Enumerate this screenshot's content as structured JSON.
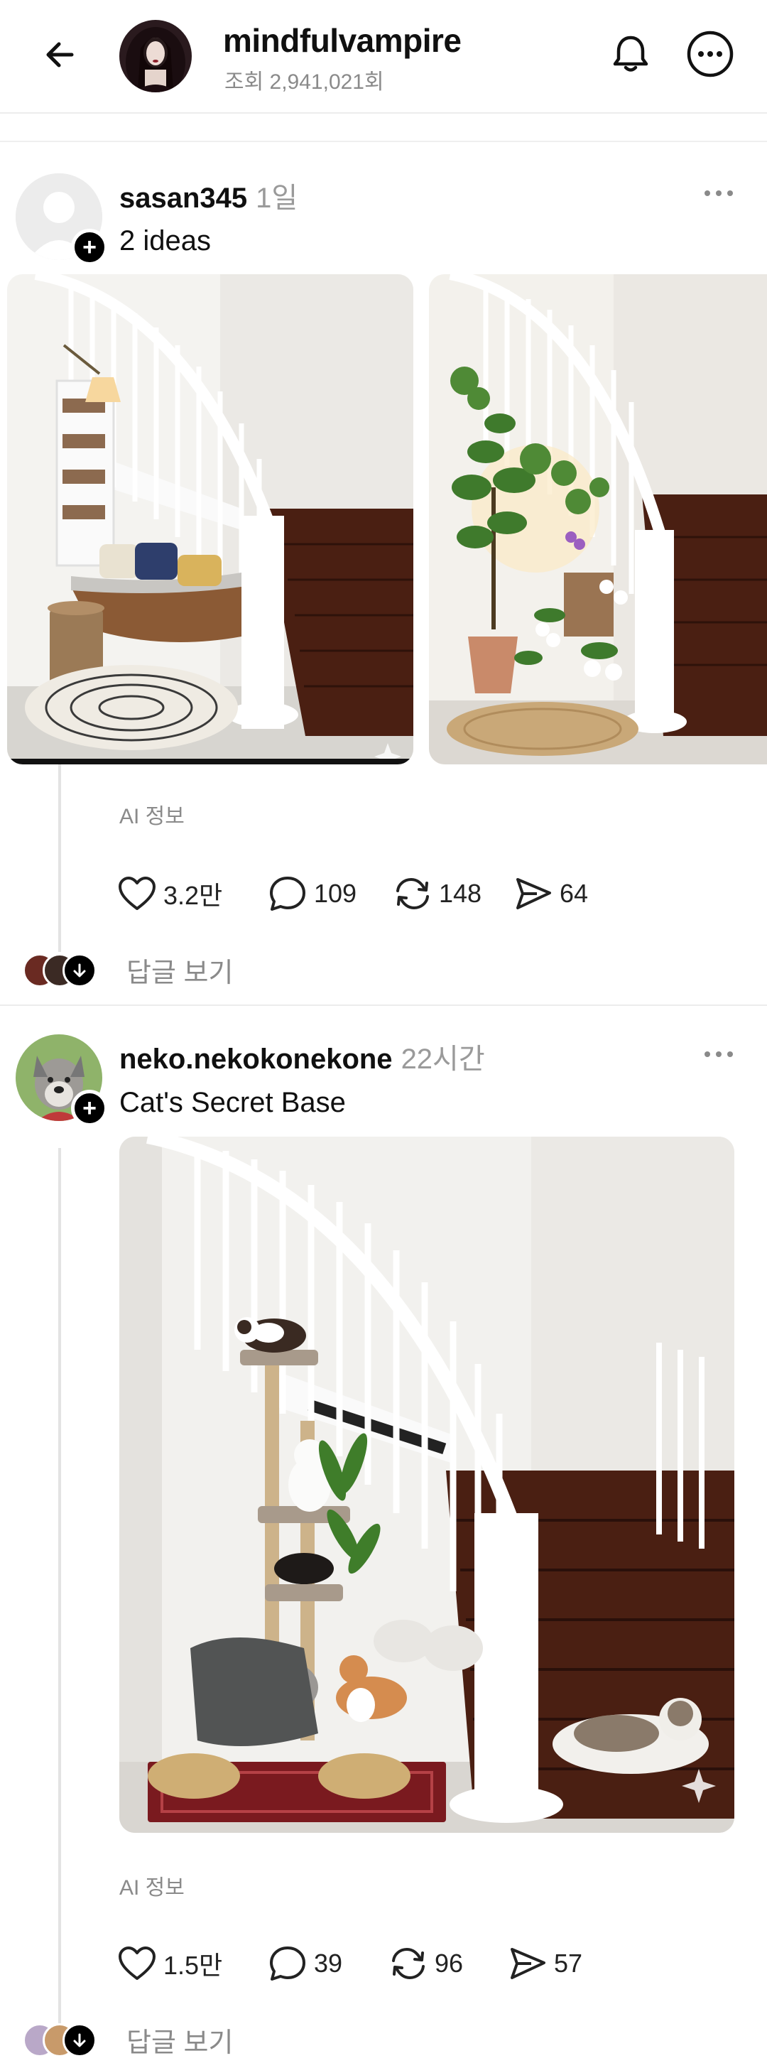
{
  "header": {
    "back_icon": "arrow-left-icon",
    "name": "mindfulvampire",
    "views": "조회 2,941,021회",
    "bell_icon": "bell-icon",
    "more_icon": "more-circle-icon"
  },
  "posts": [
    {
      "username": "sasan345",
      "time": "1일",
      "text": "2 ideas",
      "photos": [
        "reading-nook-under-stairs-photo",
        "plant-corner-under-stairs-photo"
      ],
      "ai_info": "AI 정보",
      "likes": "3.2만",
      "comments": "109",
      "reposts": "148",
      "shares": "64",
      "replies_label": "답글 보기"
    },
    {
      "username": "neko.nekokonekone",
      "time": "22시간",
      "text": "Cat's Secret Base",
      "photos": [
        "cat-tower-under-stairs-photo"
      ],
      "ai_info": "AI 정보",
      "likes": "1.5만",
      "comments": "39",
      "reposts": "96",
      "shares": "57",
      "replies_label": "답글 보기"
    }
  ],
  "colors": {
    "text": "#101010",
    "muted": "#8a8a8a",
    "divider": "#ececec",
    "stair_wood": "#4a1f12",
    "wall": "#f3f2ef"
  }
}
